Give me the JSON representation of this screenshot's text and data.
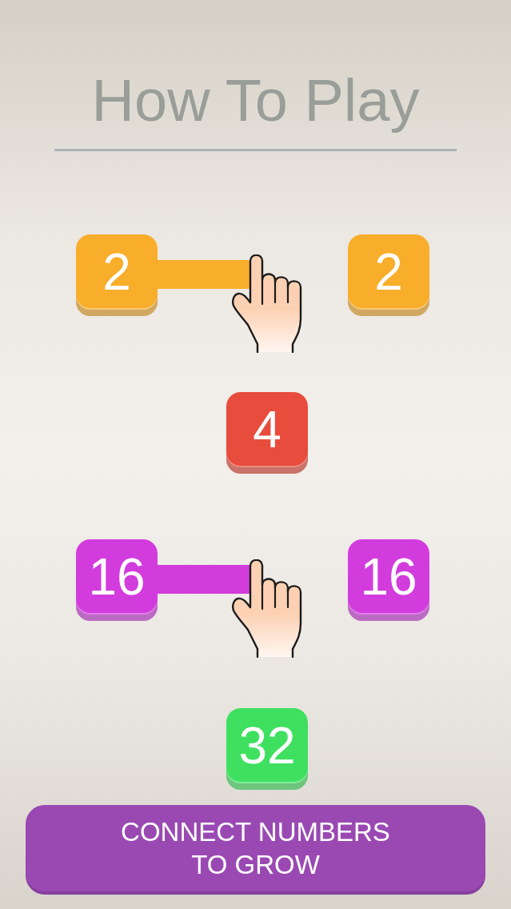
{
  "title": "How To Play",
  "steps": [
    {
      "kind": "pair",
      "color": "#f8ad2b",
      "tiles": [
        {
          "value": "2"
        },
        {
          "value": "2"
        }
      ]
    },
    {
      "kind": "result",
      "color": "#e84c3d",
      "tiles": [
        {
          "value": "4"
        }
      ]
    },
    {
      "kind": "pair",
      "color": "#d23cdd",
      "tiles": [
        {
          "value": "16"
        },
        {
          "value": "16"
        }
      ]
    },
    {
      "kind": "result",
      "color": "#3fe060",
      "tiles": [
        {
          "value": "32"
        }
      ]
    }
  ],
  "button": {
    "label": "CONNECT NUMBERS TO GROW"
  }
}
